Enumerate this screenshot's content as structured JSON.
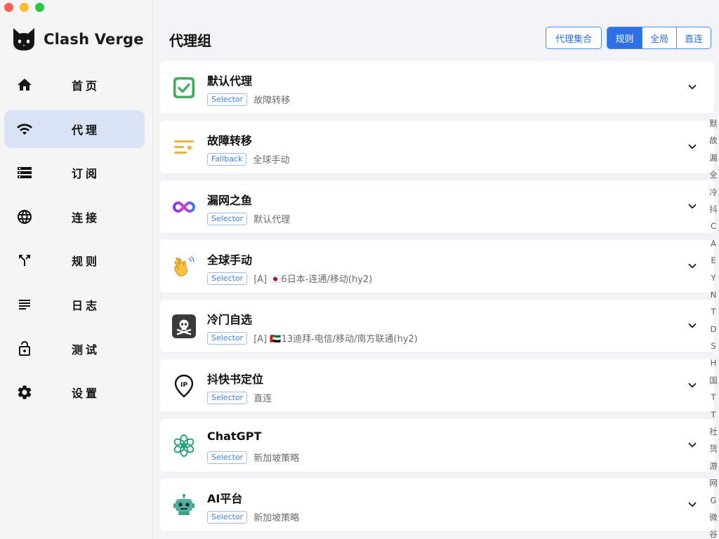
{
  "app": {
    "name": "Clash Verge"
  },
  "nav": [
    {
      "label": "首页",
      "icon": "home-icon",
      "key": "home"
    },
    {
      "label": "代理",
      "icon": "wifi-icon",
      "key": "proxy",
      "active": true
    },
    {
      "label": "订阅",
      "icon": "storage-icon",
      "key": "profile"
    },
    {
      "label": "连接",
      "icon": "globe-icon",
      "key": "connections"
    },
    {
      "label": "规则",
      "icon": "fork-icon",
      "key": "rules"
    },
    {
      "label": "日志",
      "icon": "list-icon",
      "key": "logs"
    },
    {
      "label": "测试",
      "icon": "lock-open-icon",
      "key": "test"
    },
    {
      "label": "设置",
      "icon": "gear-icon",
      "key": "settings"
    }
  ],
  "header": {
    "title": "代理组",
    "provider_button": "代理集合",
    "modes": [
      {
        "label": "规则",
        "active": true
      },
      {
        "label": "全局",
        "active": false
      },
      {
        "label": "直连",
        "active": false
      }
    ]
  },
  "groups": [
    {
      "name": "默认代理",
      "type": "Selector",
      "current": "故障转移",
      "icon": "green-check-icon"
    },
    {
      "name": "故障转移",
      "type": "Fallback",
      "current": "全球手动",
      "icon": "orange-list-star-icon"
    },
    {
      "name": "漏网之鱼",
      "type": "Selector",
      "current": "默认代理",
      "icon": "infinity-loop-icon"
    },
    {
      "name": "全球手动",
      "type": "Selector",
      "current": "[A] 🇯🇵6日本-连通/移动(hy2)",
      "icon": "waving-hand-icon"
    },
    {
      "name": "冷门自选",
      "type": "Selector",
      "current": "[A] 🇦🇪13迪拜-电信/移动/南方联通(hy2)",
      "icon": "skull-crossbones-icon"
    },
    {
      "name": "抖快书定位",
      "type": "Selector",
      "current": "直连",
      "icon": "ip-location-pin-icon"
    },
    {
      "name": "ChatGPT",
      "type": "Selector",
      "current": "新加坡策略",
      "icon": "openai-logo-icon"
    },
    {
      "name": "AI平台",
      "type": "Selector",
      "current": "新加坡策略",
      "icon": "robot-icon"
    }
  ],
  "index_letters": [
    "默",
    "故",
    "漏",
    "全",
    "冷",
    "抖",
    "C",
    "A",
    "E",
    "Y",
    "N",
    "T",
    "D",
    "S",
    "H",
    "国",
    "T",
    "T",
    "社",
    "货",
    "游",
    "网",
    "G",
    "微",
    "谷"
  ],
  "colors": {
    "accent": "#2f6fe4",
    "active_nav_bg": "#d9e3f3"
  }
}
